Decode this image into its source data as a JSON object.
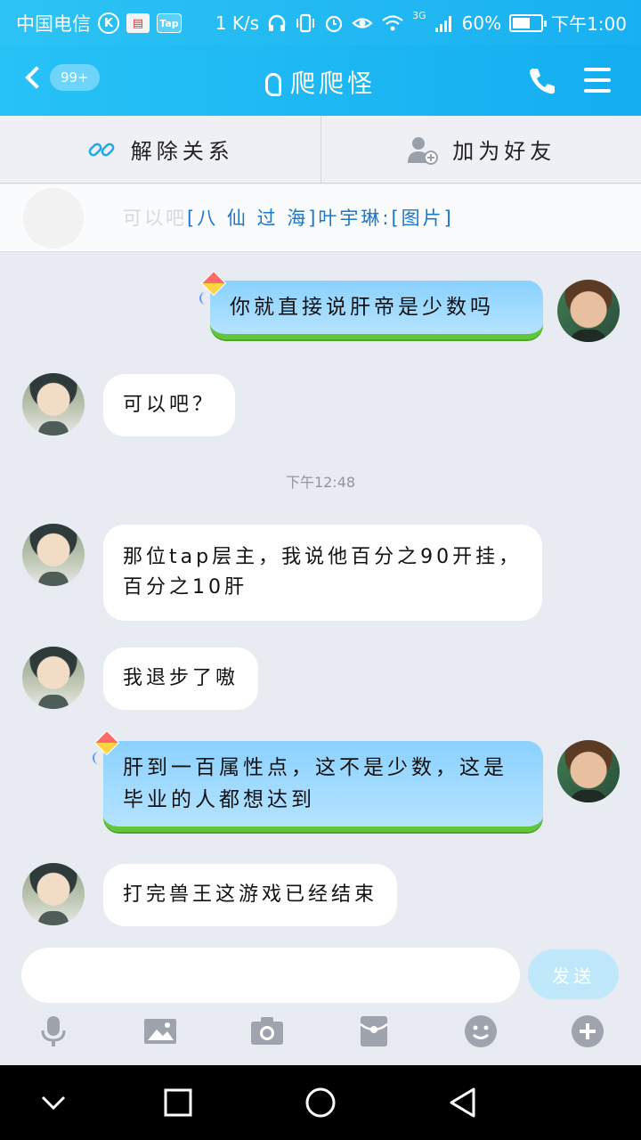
{
  "status_bar": {
    "carrier": "中国电信",
    "speed": "1 K/s",
    "network": "3G",
    "battery_percent": "60%",
    "battery_level": 0.6,
    "time": "下午1:00",
    "app_icons": [
      "kuwo-k-icon",
      "book-icon",
      "tap-icon"
    ],
    "tap_label": "Tap"
  },
  "nav_bar": {
    "badge": "99+",
    "title": "爬爬怪",
    "accent_color": "#19b0f1"
  },
  "action_bar": {
    "unfriend_label": "解除关系",
    "add_friend_label": "加为好友"
  },
  "banner": {
    "ghost_text": "可以吧",
    "text": "[八 仙 过 海]叶宇琳:[图片]"
  },
  "messages": [
    {
      "side": "right",
      "text": "你就直接说肝帝是少数吗"
    },
    {
      "side": "left",
      "text": "可以吧？"
    },
    {
      "side": "left",
      "text": "那位tap层主，我说他百分之90开挂，百分之10肝"
    },
    {
      "side": "left",
      "text": "我退步了嗷"
    },
    {
      "side": "right",
      "text": "肝到一百属性点，这不是少数，这是毕业的人都想达到"
    },
    {
      "side": "left",
      "text": "打完兽王这游戏已经结束"
    }
  ],
  "timestamp": "下午12:48",
  "input": {
    "value": "",
    "placeholder": "",
    "send_label": "发送"
  },
  "toolbar": [
    "microphone-icon",
    "image-icon",
    "camera-icon",
    "red-packet-icon",
    "emoji-icon",
    "plus-icon"
  ],
  "system_nav": [
    "collapse-icon",
    "recents-icon",
    "home-icon",
    "back-icon"
  ]
}
